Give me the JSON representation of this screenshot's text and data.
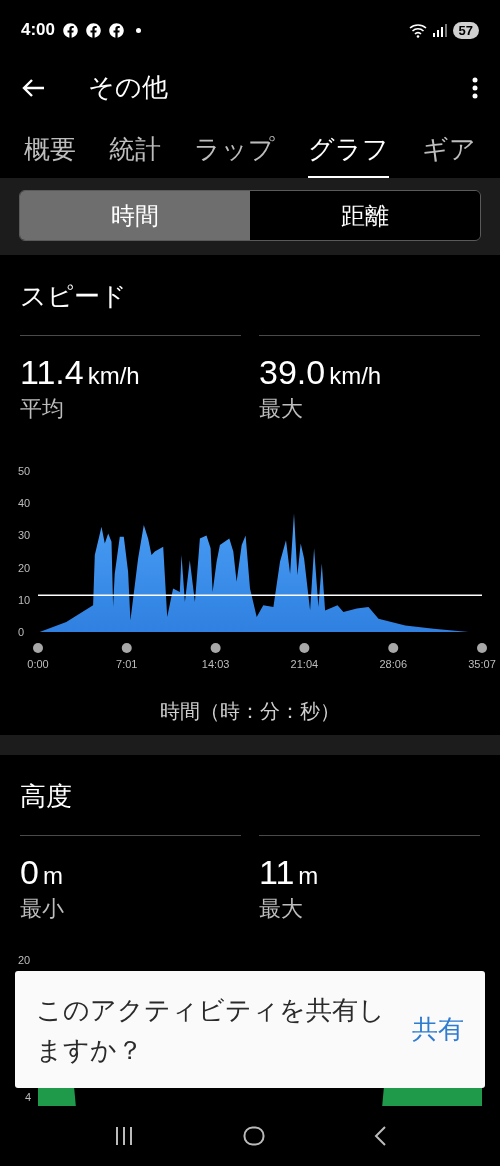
{
  "status_bar": {
    "time": "4:00",
    "battery": "57"
  },
  "header": {
    "title": "その他"
  },
  "tabs": [
    {
      "label": "概要",
      "selected": false
    },
    {
      "label": "統計",
      "selected": false
    },
    {
      "label": "ラップ",
      "selected": false
    },
    {
      "label": "グラフ",
      "selected": true
    },
    {
      "label": "ギア",
      "selected": false
    }
  ],
  "segments": [
    {
      "label": "時間",
      "selected": true
    },
    {
      "label": "距離",
      "selected": false
    }
  ],
  "speed": {
    "title": "スピード",
    "stats": [
      {
        "value": "11.4",
        "unit": "km/h",
        "label": "平均"
      },
      {
        "value": "39.0",
        "unit": "km/h",
        "label": "最大"
      }
    ],
    "chart_data": {
      "type": "area",
      "xlabel": "時間（時：分：秒）",
      "xlim": [
        0,
        35.12
      ],
      "ylim": [
        0,
        50
      ],
      "yticks": [
        0,
        10,
        20,
        30,
        40,
        50
      ],
      "xticks": [
        {
          "value": 0,
          "label": "0:00"
        },
        {
          "value": 7.02,
          "label": "7:01"
        },
        {
          "value": 14.05,
          "label": "14:03"
        },
        {
          "value": 21.07,
          "label": "21:04"
        },
        {
          "value": 28.1,
          "label": "28:06"
        },
        {
          "value": 35.12,
          "label": "35:07"
        }
      ],
      "x": [
        0.13,
        2.24,
        4.36,
        4.49,
        5.02,
        5.28,
        5.55,
        5.81,
        5.94,
        6.07,
        6.47,
        6.79,
        7.13,
        7.31,
        7.92,
        8.37,
        8.71,
        8.98,
        9.24,
        9.9,
        10.22,
        10.69,
        11.22,
        11.35,
        11.62,
        12.01,
        12.41,
        12.81,
        13.33,
        13.65,
        13.81,
        14.13,
        14.39,
        15.13,
        15.45,
        15.71,
        16.11,
        16.42,
        16.77,
        17.3,
        17.82,
        18.62,
        19.14,
        19.62,
        19.94,
        20.25,
        20.52,
        20.78,
        21.05,
        21.52,
        21.84,
        22.18,
        22.45,
        22.71,
        23.69,
        24.16,
        25.22,
        26.14,
        26.93,
        29.05,
        31.29,
        34.06
      ],
      "series": [
        {
          "color": "#2f80e0",
          "values": [
            0,
            3.1,
            8.3,
            23.9,
            32.7,
            27.5,
            30.6,
            28,
            7.8,
            18,
            29.6,
            29.6,
            18.7,
            3.6,
            22.8,
            33.2,
            29,
            23.9,
            25,
            26.5,
            4.7,
            13.5,
            12.4,
            23.9,
            9.3,
            22.3,
            9.3,
            29,
            30,
            26,
            12.4,
            21.8,
            27,
            29,
            25,
            15.6,
            27,
            30,
            13.5,
            4.7,
            8.3,
            7.8,
            21.8,
            28.5,
            18,
            36.8,
            17.6,
            27.5,
            22.8,
            6.7,
            26,
            7.8,
            21.3,
            6.7,
            8.3,
            6.2,
            7.3,
            7.8,
            4.1,
            2,
            1,
            0
          ]
        }
      ],
      "ref_lines": [
        {
          "axis": "y",
          "value": 11.4
        }
      ]
    }
  },
  "elevation": {
    "title": "高度",
    "stats": [
      {
        "value": "0",
        "unit": "m",
        "label": "最小"
      },
      {
        "value": "11",
        "unit": "m",
        "label": "最大"
      }
    ],
    "axis_labels": [
      "20",
      "4"
    ]
  },
  "share_prompt": {
    "message": "このアクティビティを共有しますか？",
    "action": "共有"
  }
}
